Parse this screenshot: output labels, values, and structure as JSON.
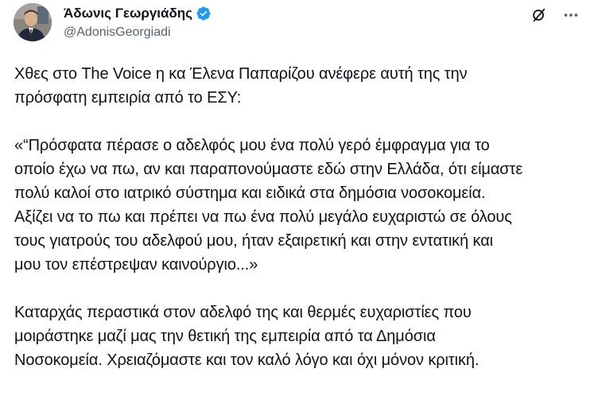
{
  "author": {
    "display_name": "Άδωνις Γεωργιάδης",
    "handle": "@AdonisGeorgiadi",
    "verified_icon": "verified-badge-icon",
    "verified_color": "#1d9bf0"
  },
  "actions": {
    "grok_icon": "grok-slash-icon",
    "more_icon": "more-dots-icon"
  },
  "tweet": {
    "paragraphs": [
      {
        "lines": [
          "Χθες στο The Voice η κα Έλενα Παπαρίζου ανέφερε αυτή της την",
          "πρόσφατη εμπειρία από το ΕΣΥ:"
        ]
      },
      {
        "lines": [
          "«“Πρόσφατα πέρασε ο αδελφός μου ένα πολύ γερό έμφραγμα για το",
          "οποίο έχω να πω, αν και παραπονούμαστε εδώ στην Ελλάδα, ότι είμαστε",
          "πολύ καλοί στο ιατρικό σύστημα και ειδικά στα δημόσια νοσοκομεία.",
          "Αξίζει να το πω και πρέπει να πω ένα πολύ μεγάλο ευχαριστώ σε όλους",
          "τους γιατρούς του αδελφού μου, ήταν εξαιρετική και στην εντατική και",
          "μου τον επέστρεψαν καινούργιο...»"
        ]
      },
      {
        "lines": [
          "Καταρχάς περαστικά στον αδελφό της και θερμές ευχαριστίες που",
          "μοιράστηκε μαζί μας την θετική της εμπειρία από τα Δημόσια",
          "Νοσοκομεία. Χρειαζόμαστε και τον καλό λόγο και όχι μόνον κριτική."
        ]
      }
    ]
  }
}
